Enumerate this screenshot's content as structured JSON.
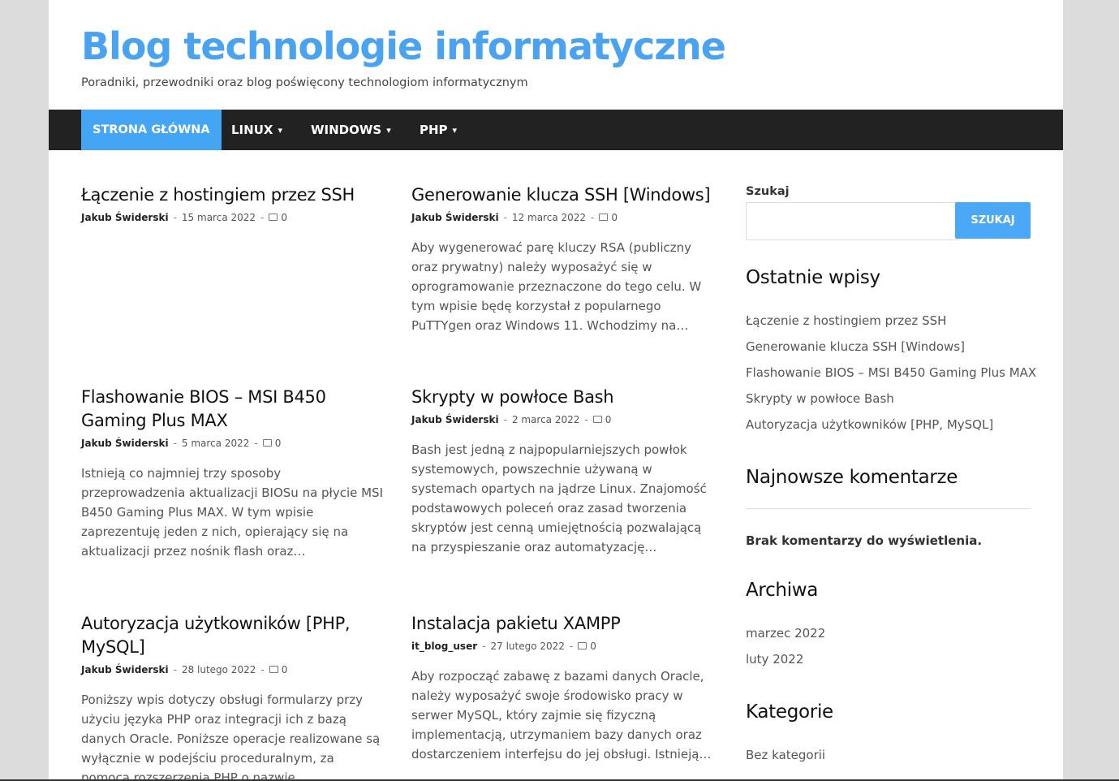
{
  "site": {
    "title": "Blog technologie informatyczne",
    "description": "Poradniki, przewodniki oraz blog poświęcony technologiom informatycznym"
  },
  "nav": {
    "items": [
      {
        "label": "Strona główna",
        "active": true
      },
      {
        "label": "Linux",
        "has_dropdown": true
      },
      {
        "label": "Windows",
        "has_dropdown": true
      },
      {
        "label": "PHP",
        "has_dropdown": true
      }
    ],
    "chevron": "▾"
  },
  "posts": [
    {
      "title": "Łączenie z hostingiem przez SSH",
      "author": "Jakub Świderski",
      "date": "15 marca 2022",
      "comments": "0",
      "excerpt": ""
    },
    {
      "title": "Generowanie klucza SSH [Windows]",
      "author": "Jakub Świderski",
      "date": "12 marca 2022",
      "comments": "0",
      "excerpt": "Aby wygenerować parę kluczy RSA (publiczny oraz prywatny) należy wyposażyć się w oprogramowanie przeznaczone do tego celu. W tym wpisie będę korzystał z popularnego PuTTYgen oraz Windows 11. Wchodzimy na…"
    },
    {
      "title": "Flashowanie BIOS – MSI B450 Gaming Plus MAX",
      "author": "Jakub Świderski",
      "date": "5 marca 2022",
      "comments": "0",
      "excerpt": "Istnieją co najmniej trzy sposoby przeprowadzenia aktualizacji BIOSu na płycie MSI B450 Gaming Plus MAX. W tym wpisie zaprezentuję jeden z nich, opierający się na aktualizacji przez nośnik flash oraz…"
    },
    {
      "title": "Skrypty w powłoce Bash",
      "author": "Jakub Świderski",
      "date": "2 marca 2022",
      "comments": "0",
      "excerpt": "Bash jest jedną z najpopularniejszych powłok systemowych, powszechnie używaną w systemach opartych na jądrze Linux. Znajomość podstawowych poleceń oraz zasad tworzenia skryptów jest cenną umiejętnością pozwalającą na przyspieszanie oraz automatyzację…"
    },
    {
      "title": "Autoryzacja użytkowników [PHP, MySQL]",
      "author": "Jakub Świderski",
      "date": "28 lutego 2022",
      "comments": "0",
      "excerpt": "Poniższy wpis dotyczy obsługi formularzy przy użyciu języka PHP oraz integracji ich z bazą danych Oracle. Poniższe operacje realizowane są wyłącznie w podejściu proceduralnym, za pomocą rozszerzenia PHP o nazwie…"
    },
    {
      "title": "Instalacja pakietu XAMPP",
      "author": "it_blog_user",
      "date": "27 lutego 2022",
      "comments": "0",
      "excerpt": "Aby rozpocząć zabawę z bazami danych Oracle, należy wyposażyć swoje środowisko pracy w serwer MySQL, który zajmie się fizyczną implementacją, utrzymaniem bazy danych oraz dostarczeniem interfejsu do jej obsługi. Istnieją…"
    }
  ],
  "meta_sep": "-",
  "sidebar": {
    "search": {
      "label": "Szukaj",
      "value": "",
      "button": "SZUKAJ"
    },
    "recent_posts": {
      "title": "Ostatnie wpisy",
      "items": [
        "Łączenie z hostingiem przez SSH",
        "Generowanie klucza SSH [Windows]",
        "Flashowanie BIOS – MSI B450 Gaming Plus MAX",
        "Skrypty w powłoce Bash",
        "Autoryzacja użytkowników [PHP, MySQL]"
      ]
    },
    "recent_comments": {
      "title": "Najnowsze komentarze",
      "empty": "Brak komentarzy do wyświetlenia."
    },
    "archives": {
      "title": "Archiwa",
      "items": [
        "marzec 2022",
        "luty 2022"
      ]
    },
    "categories": {
      "title": "Kategorie",
      "items": [
        "Bez kategorii"
      ]
    }
  },
  "colors": {
    "accent": "#4aa3f0",
    "nav_bg": "#222222",
    "page_bg": "#dcdcdc"
  }
}
